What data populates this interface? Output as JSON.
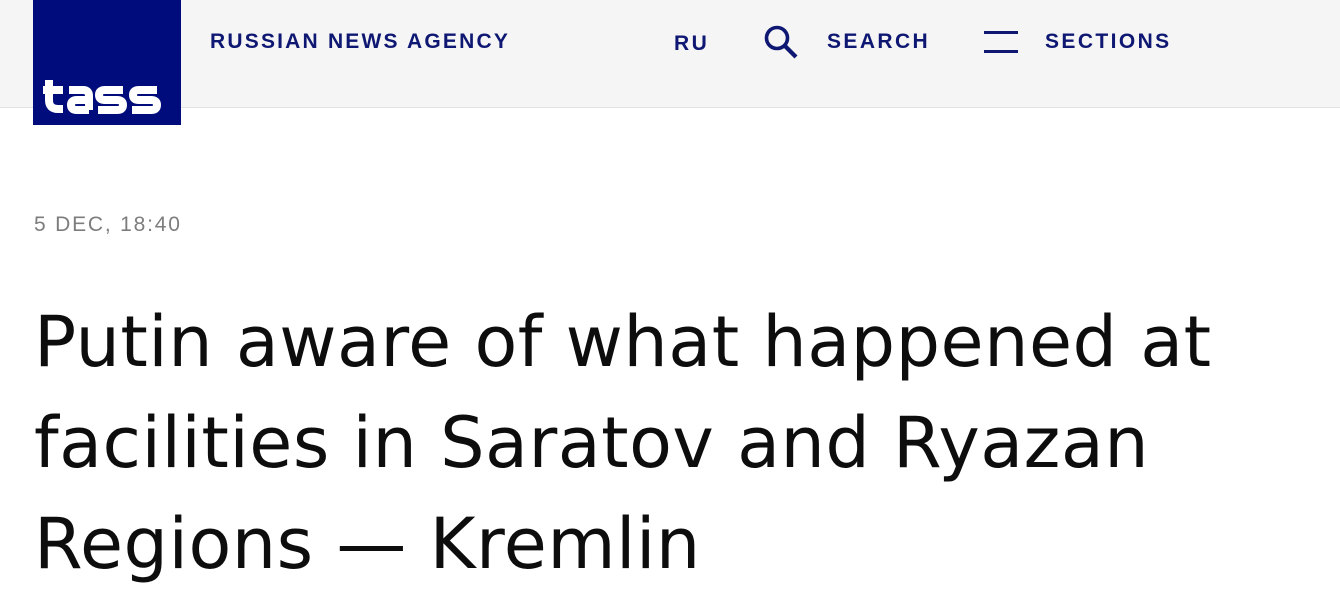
{
  "header": {
    "logo_text": "TASS",
    "agency_name": "RUSSIAN NEWS AGENCY",
    "nav": {
      "lang_label": "RU",
      "search_label": "SEARCH",
      "sections_label": "SECTIONS"
    },
    "icons": {
      "search": "search-icon",
      "sections": "hamburger-menu-icon"
    }
  },
  "article": {
    "dateline": "5 DEC, 18:40",
    "headline": "Putin aware of what happened at facilities in Saratov and Ryazan Regions — Kremlin"
  },
  "colors": {
    "brand_navy": "#000c7c",
    "nav_text": "#0e1772",
    "header_bg": "#f5f5f5",
    "dateline_gray": "#7d7d7d",
    "headline_text": "#0d0d0d"
  }
}
